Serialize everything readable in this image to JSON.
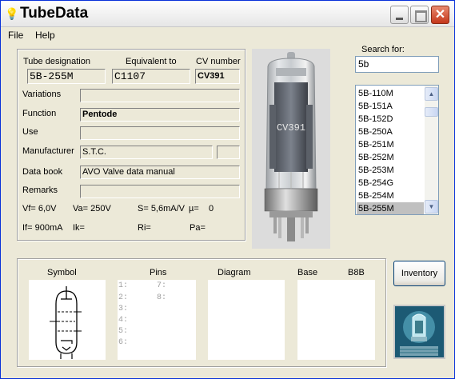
{
  "window": {
    "title": "TubeData",
    "title_icon": "bulb-icon"
  },
  "menu": {
    "file": "File",
    "help": "Help"
  },
  "header": {
    "designation_label": "Tube designation",
    "equivalent_label": "Equivalent to",
    "cv_label": "CV number",
    "designation_value": "5B-255M",
    "equivalent_value": "C1107",
    "cv_value": "CV391"
  },
  "details": {
    "variations_label": "Variations",
    "variations_value": "",
    "function_label": "Function",
    "function_value": "Pentode",
    "use_label": "Use",
    "use_value": "",
    "manufacturer_label": "Manufacturer",
    "manufacturer_value": "S.T.C.",
    "manufacturer_code": "",
    "databook_label": "Data book",
    "databook_value": "AVO Valve data manual",
    "remarks_label": "Remarks",
    "remarks_value": ""
  },
  "specs": {
    "vf": "Vf= 6,0V",
    "va": "Va= 250V",
    "s": "S= 5,6mA/V",
    "mu": "µ=",
    "mu_value": "0",
    "if": "If= 900mA",
    "ik": "Ik=",
    "ri": "Ri=",
    "pa": "Pa="
  },
  "search": {
    "label": "Search for:",
    "value": "5b"
  },
  "list": {
    "items": [
      "5B-110M",
      "5B-151A",
      "5B-152D",
      "5B-250A",
      "5B-251M",
      "5B-252M",
      "5B-253M",
      "5B-254G",
      "5B-254M",
      "5B-255M"
    ],
    "selected": "5B-255M"
  },
  "bottom": {
    "symbol_label": "Symbol",
    "pins_label": "Pins",
    "diagram_label": "Diagram",
    "base_label": "Base",
    "base_value": "B8B",
    "pins": [
      "1:",
      "2:",
      "3:",
      "4:",
      "5:",
      "6:",
      "7:",
      "8:"
    ]
  },
  "buttons": {
    "inventory": "Inventory"
  },
  "photo": {
    "tube_marking": "CV391"
  },
  "colors": {
    "titlebar_close": "#c4371b",
    "selected_row": "#c0c0c0",
    "logo_bg": "#1c5a74"
  }
}
